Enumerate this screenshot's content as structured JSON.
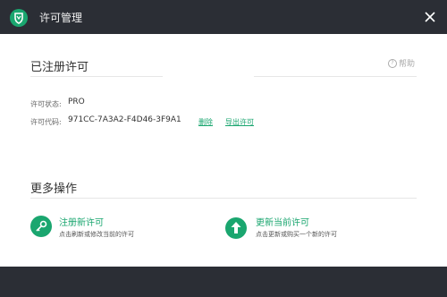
{
  "window": {
    "title": "许可管理"
  },
  "registered": {
    "section_title": "已注册许可",
    "help_label": "帮助",
    "status_label": "许可状态:",
    "status_value": "PRO",
    "code_label": "许可代码:",
    "code_value": "971CC-7A3A2-F4D46-3F9A1",
    "delete_link": "删除",
    "export_link": "导出许可"
  },
  "more": {
    "section_title": "更多操作",
    "register_title": "注册新许可",
    "register_desc": "点击刷新或修改当前的许可",
    "update_title": "更新当前许可",
    "update_desc": "点击更新或购买一个新的许可"
  },
  "colors": {
    "accent": "#1aa66f",
    "titlebar": "#2b2e35"
  },
  "icons": {
    "logo": "shield-logo-icon",
    "close": "close-icon",
    "help": "question-icon",
    "register": "key-icon",
    "update": "arrow-up-icon"
  }
}
